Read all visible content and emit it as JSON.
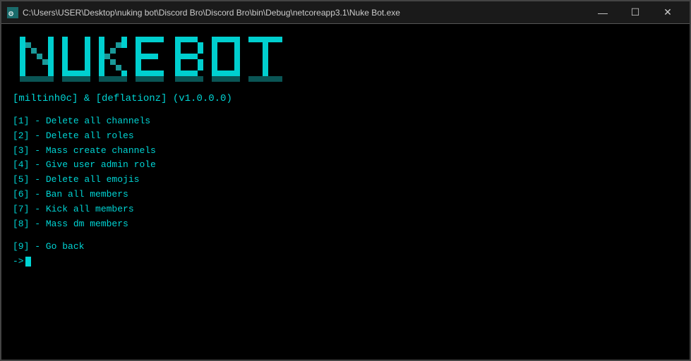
{
  "window": {
    "titlebar": {
      "path": "C:\\Users\\USER\\Desktop\\nuking bot\\Discord Bro\\Discord Bro\\bin\\Debug\\netcoreapp3.1\\Nuke Bot.exe",
      "minimize_label": "—",
      "maximize_label": "☐",
      "close_label": "✕"
    }
  },
  "console": {
    "credits": "[miltinh0c] & [deflationz] (v1.0.0.0)",
    "menu_items": [
      {
        "key": "[1]",
        "label": "- Delete all channels"
      },
      {
        "key": "[2]",
        "label": "- Delete all roles"
      },
      {
        "key": "[3]",
        "label": "- Mass create channels"
      },
      {
        "key": "[4]",
        "label": "- Give user admin role"
      },
      {
        "key": "[5]",
        "label": "- Delete all emojis"
      },
      {
        "key": "[6]",
        "label": "- Ban all members"
      },
      {
        "key": "[7]",
        "label": "- Kick all members"
      },
      {
        "key": "[8]",
        "label": "- Mass dm members"
      }
    ],
    "go_back": "[9]  - Go back",
    "prompt": "-> "
  }
}
